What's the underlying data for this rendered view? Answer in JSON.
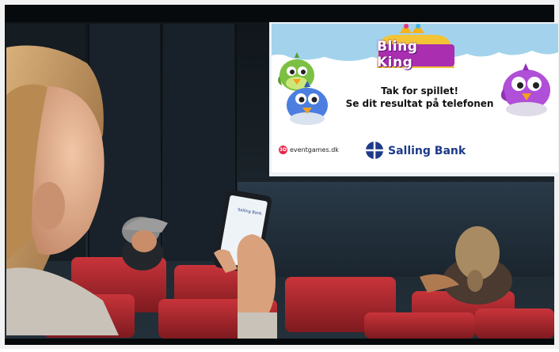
{
  "screen": {
    "game_title": "Bling King",
    "message_line1": "Tak for spillet!",
    "message_line2": "Se dit resultat på telefonen",
    "event_logo_text": "eventgames.dk",
    "event_logo_badge": "3D",
    "bank_logo_text": "Salling Bank"
  },
  "phone": {
    "screen_text": "Salling Bank"
  },
  "colors": {
    "screen_sky": "#9fd0ea",
    "theater_wall": "#1b2228",
    "seat_red": "#b3252b",
    "bank_blue": "#1e3a8a"
  }
}
